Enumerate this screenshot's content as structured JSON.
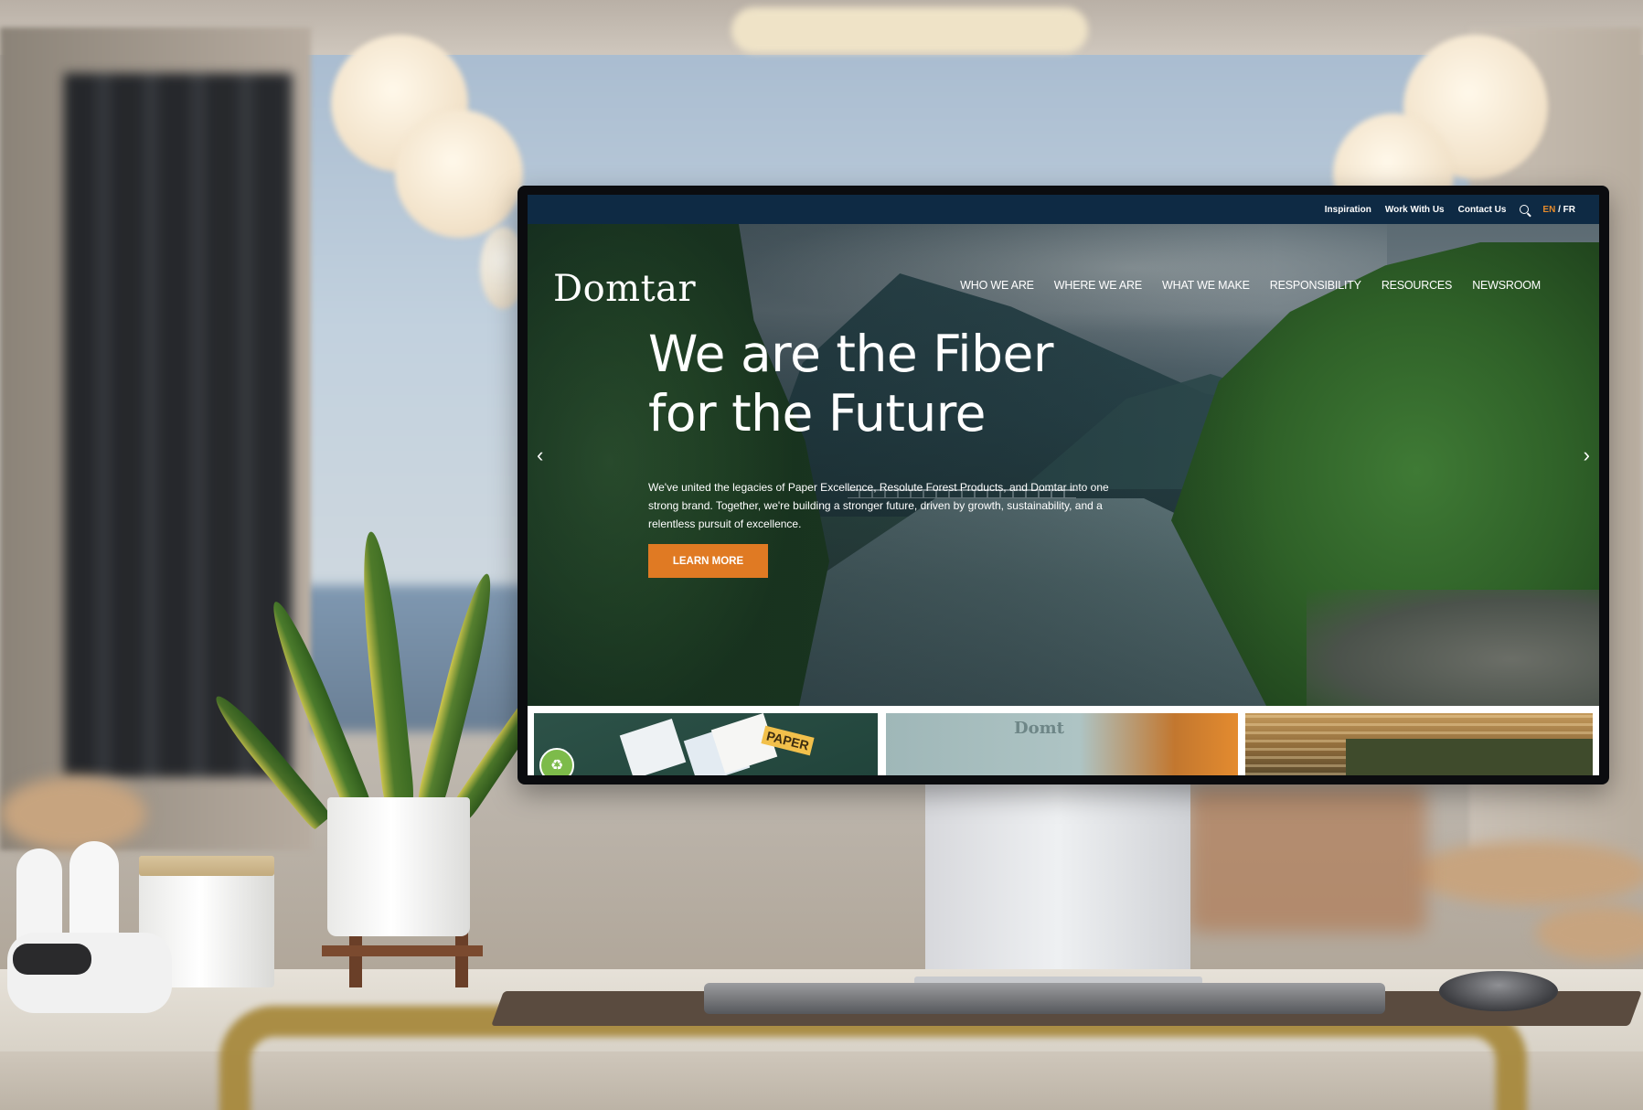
{
  "site": {
    "utility_links": [
      "Inspiration",
      "Work With Us",
      "Contact Us"
    ],
    "lang_en": "EN",
    "lang_sep": " / ",
    "lang_fr": "FR",
    "logo": "Domtar",
    "nav": [
      "WHO WE ARE",
      "WHERE WE ARE",
      "WHAT WE MAKE",
      "RESPONSIBILITY",
      "RESOURCES",
      "NEWSROOM"
    ],
    "hero": {
      "title_line1": "We are the Fiber",
      "title_line2": "for the Future",
      "text": "We've united the legacies of Paper Excellence, Resolute Forest Products, and Domtar into one strong brand. Together, we're building a stronger future, driven by growth, sustainability, and a relentless pursuit of excellence.",
      "cta": "LEARN MORE"
    },
    "cards": {
      "card1_label": "PAPER",
      "card2_label": "Domt"
    },
    "icons": {
      "search": "search-icon",
      "prev": "chevron-left-icon",
      "next": "chevron-right-icon"
    },
    "colors": {
      "topbar": "#0e2a44",
      "accent": "#e07a23",
      "lang_active": "#e58a2b"
    }
  }
}
